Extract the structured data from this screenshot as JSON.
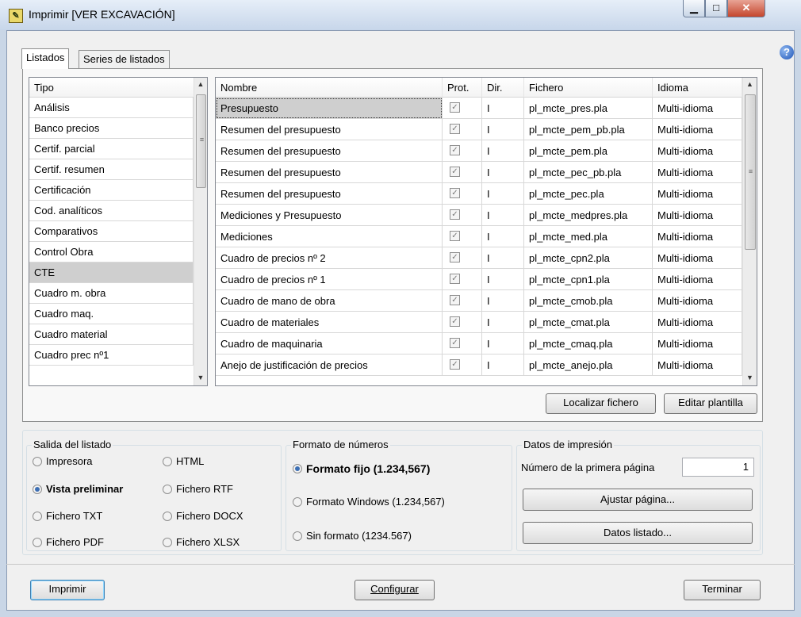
{
  "window": {
    "title": "Imprimir [VER EXCAVACIÓN]",
    "minimize_glyph": "▁",
    "maximize_glyph": "□",
    "close_glyph": "✕",
    "help_glyph": "?"
  },
  "tabs": [
    {
      "label": "Listados",
      "active": true
    },
    {
      "label": "Series de listados",
      "active": false
    }
  ],
  "tipo_list": {
    "header": "Tipo",
    "selected": "CTE",
    "items": [
      "Análisis",
      "Banco precios",
      "Certif. parcial",
      "Certif. resumen",
      "Certificación",
      "Cod. analíticos",
      "Comparativos",
      "Control Obra",
      "CTE",
      "Cuadro m. obra",
      "Cuadro maq.",
      "Cuadro material",
      "Cuadro prec nº1"
    ]
  },
  "listados_table": {
    "columns": [
      "Nombre",
      "Prot.",
      "Dir.",
      "Fichero",
      "Idioma"
    ],
    "rows": [
      {
        "nombre": "Presupuesto",
        "prot": true,
        "dir": "I",
        "fichero": "pl_mcte_pres.pla",
        "idioma": "Multi-idioma",
        "selected": true
      },
      {
        "nombre": "Resumen del presupuesto",
        "prot": true,
        "dir": "I",
        "fichero": "pl_mcte_pem_pb.pla",
        "idioma": "Multi-idioma"
      },
      {
        "nombre": "Resumen del presupuesto",
        "prot": true,
        "dir": "I",
        "fichero": "pl_mcte_pem.pla",
        "idioma": "Multi-idioma"
      },
      {
        "nombre": "Resumen del presupuesto",
        "prot": true,
        "dir": "I",
        "fichero": "pl_mcte_pec_pb.pla",
        "idioma": "Multi-idioma"
      },
      {
        "nombre": "Resumen del presupuesto",
        "prot": true,
        "dir": "I",
        "fichero": "pl_mcte_pec.pla",
        "idioma": "Multi-idioma"
      },
      {
        "nombre": "Mediciones y Presupuesto",
        "prot": true,
        "dir": "I",
        "fichero": "pl_mcte_medpres.pla",
        "idioma": "Multi-idioma"
      },
      {
        "nombre": "Mediciones",
        "prot": true,
        "dir": "I",
        "fichero": "pl_mcte_med.pla",
        "idioma": "Multi-idioma"
      },
      {
        "nombre": "Cuadro de precios nº 2",
        "prot": true,
        "dir": "I",
        "fichero": "pl_mcte_cpn2.pla",
        "idioma": "Multi-idioma"
      },
      {
        "nombre": "Cuadro de precios nº 1",
        "prot": true,
        "dir": "I",
        "fichero": "pl_mcte_cpn1.pla",
        "idioma": "Multi-idioma"
      },
      {
        "nombre": "Cuadro de mano de obra",
        "prot": true,
        "dir": "I",
        "fichero": "pl_mcte_cmob.pla",
        "idioma": "Multi-idioma"
      },
      {
        "nombre": "Cuadro de materiales",
        "prot": true,
        "dir": "I",
        "fichero": "pl_mcte_cmat.pla",
        "idioma": "Multi-idioma"
      },
      {
        "nombre": "Cuadro de maquinaria",
        "prot": true,
        "dir": "I",
        "fichero": "pl_mcte_cmaq.pla",
        "idioma": "Multi-idioma"
      },
      {
        "nombre": "Anejo de justificación de precios",
        "prot": true,
        "dir": "I",
        "fichero": "pl_mcte_anejo.pla",
        "idioma": "Multi-idioma"
      }
    ]
  },
  "table_buttons": {
    "localizar": "Localizar fichero",
    "editar": "Editar plantilla"
  },
  "salida": {
    "title": "Salida del listado",
    "selected": "Vista preliminar",
    "options": [
      "Impresora",
      "HTML",
      "Vista preliminar",
      "Fichero RTF",
      "Fichero TXT",
      "Fichero DOCX",
      "Fichero PDF",
      "Fichero XLSX"
    ]
  },
  "formato": {
    "title": "Formato de números",
    "selected": "Formato fijo (1.234,567)",
    "options": [
      "Formato fijo (1.234,567)",
      "Formato Windows (1.234,567)",
      "Sin formato (1234.567)"
    ]
  },
  "datos_impresion": {
    "title": "Datos de impresión",
    "first_page_label": "Número de la primera página",
    "first_page_value": "1",
    "ajustar_label": "Ajustar página...",
    "datos_listado_label": "Datos listado..."
  },
  "footer": {
    "imprimir": "Imprimir",
    "configurar": "Configurar",
    "terminar": "Terminar"
  }
}
